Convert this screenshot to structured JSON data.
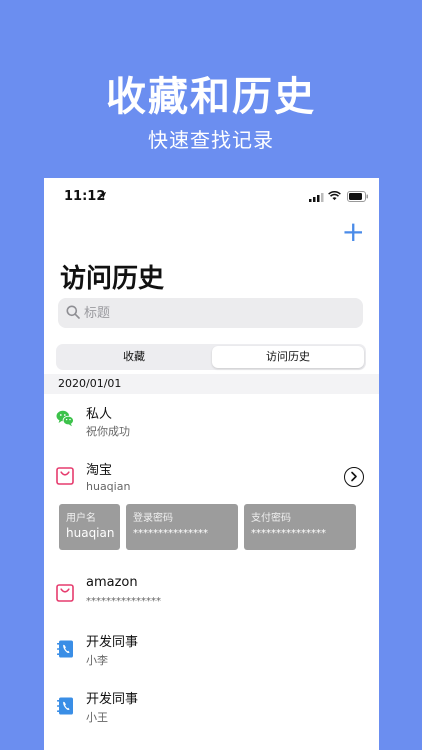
{
  "promo": {
    "title": "收藏和历史",
    "subtitle": "快速查找记录"
  },
  "status_bar": {
    "time": "11:12"
  },
  "header": {
    "add_label": "+",
    "title": "访问历史"
  },
  "search": {
    "placeholder": "标题"
  },
  "segments": [
    {
      "label": "收藏",
      "selected": false
    },
    {
      "label": "访问历史",
      "selected": true
    }
  ],
  "date_group": "2020/01/01",
  "items": [
    {
      "title": "私人",
      "subtitle": "祝你成功",
      "icon": "wechat-icon"
    },
    {
      "title": "淘宝",
      "subtitle": "huaqian",
      "icon": "shopping-bag-icon"
    },
    {
      "title": "amazon",
      "subtitle": "***************",
      "icon": "shopping-bag-icon"
    },
    {
      "title": "开发同事",
      "subtitle": "小李",
      "icon": "phone-book-icon"
    },
    {
      "title": "开发同事",
      "subtitle": "小王",
      "icon": "phone-book-icon"
    }
  ],
  "credentials": [
    {
      "label": "用户名",
      "value": "huaqian"
    },
    {
      "label": "登录密码",
      "value": "***************"
    },
    {
      "label": "支付密码",
      "value": "***************"
    }
  ],
  "colors": {
    "background": "#6b8ef0",
    "accent": "#4a8be8",
    "wechat": "#3cc24a",
    "shopping": "#e63c6e",
    "contacts": "#3a8ee6",
    "card": "#9c9c9c"
  }
}
